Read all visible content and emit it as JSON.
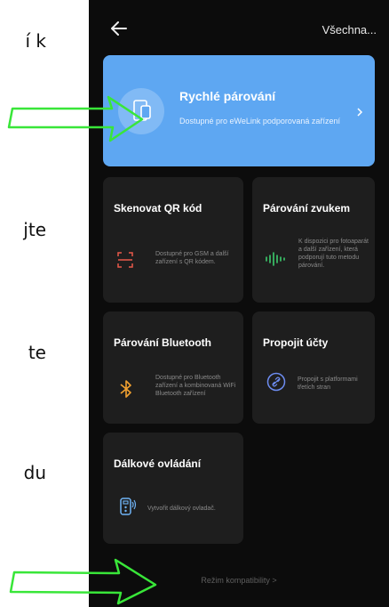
{
  "left_page": {
    "fragments": [
      "í k",
      "jte",
      "te",
      "du"
    ]
  },
  "header": {
    "back_icon": "arrow-left-icon",
    "all_label": "Všechna..."
  },
  "quick_pairing": {
    "title": "Rychlé párování",
    "description": "Dostupné pro eWeLink podporovaná zařízení",
    "bg_color": "#5ea7f2"
  },
  "cards": {
    "qr": {
      "title": "Skenovat QR kód",
      "desc": "Dostupné pro GSM a další zařízení s QR kódem."
    },
    "sound": {
      "title": "Párování zvukem",
      "desc": "K dispozici pro fotoaparát a další zařízení, která podporují tuto metodu párování."
    },
    "bluetooth": {
      "title": "Párování Bluetooth",
      "desc": "Dostupné pro Bluetooth zařízení a kombinovaná WiFi Bluetooth zařízení"
    },
    "link": {
      "title": "Propojit účty",
      "desc": "Propojit s platformami třetích stran"
    },
    "remote": {
      "title": "Dálkové ovládání",
      "desc": "Vytvořit dálkový ovladač."
    }
  },
  "footer": {
    "compat_label": "Režim kompatibility >"
  },
  "colors": {
    "accent_green": "#39e639",
    "qr_icon": "#e8584a",
    "sound_icon": "#3dcc6d",
    "bluetooth_icon": "#f0a030",
    "link_icon": "#6d8cf0",
    "remote_icon": "#6fb3f5"
  }
}
